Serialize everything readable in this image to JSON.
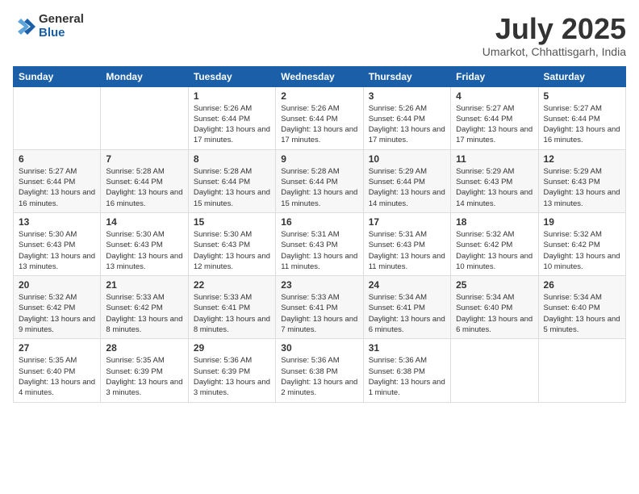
{
  "logo": {
    "general": "General",
    "blue": "Blue"
  },
  "header": {
    "month_year": "July 2025",
    "location": "Umarkot, Chhattisgarh, India"
  },
  "weekdays": [
    "Sunday",
    "Monday",
    "Tuesday",
    "Wednesday",
    "Thursday",
    "Friday",
    "Saturday"
  ],
  "weeks": [
    [
      {
        "day": "",
        "info": ""
      },
      {
        "day": "",
        "info": ""
      },
      {
        "day": "1",
        "info": "Sunrise: 5:26 AM\nSunset: 6:44 PM\nDaylight: 13 hours and 17 minutes."
      },
      {
        "day": "2",
        "info": "Sunrise: 5:26 AM\nSunset: 6:44 PM\nDaylight: 13 hours and 17 minutes."
      },
      {
        "day": "3",
        "info": "Sunrise: 5:26 AM\nSunset: 6:44 PM\nDaylight: 13 hours and 17 minutes."
      },
      {
        "day": "4",
        "info": "Sunrise: 5:27 AM\nSunset: 6:44 PM\nDaylight: 13 hours and 17 minutes."
      },
      {
        "day": "5",
        "info": "Sunrise: 5:27 AM\nSunset: 6:44 PM\nDaylight: 13 hours and 16 minutes."
      }
    ],
    [
      {
        "day": "6",
        "info": "Sunrise: 5:27 AM\nSunset: 6:44 PM\nDaylight: 13 hours and 16 minutes."
      },
      {
        "day": "7",
        "info": "Sunrise: 5:28 AM\nSunset: 6:44 PM\nDaylight: 13 hours and 16 minutes."
      },
      {
        "day": "8",
        "info": "Sunrise: 5:28 AM\nSunset: 6:44 PM\nDaylight: 13 hours and 15 minutes."
      },
      {
        "day": "9",
        "info": "Sunrise: 5:28 AM\nSunset: 6:44 PM\nDaylight: 13 hours and 15 minutes."
      },
      {
        "day": "10",
        "info": "Sunrise: 5:29 AM\nSunset: 6:44 PM\nDaylight: 13 hours and 14 minutes."
      },
      {
        "day": "11",
        "info": "Sunrise: 5:29 AM\nSunset: 6:43 PM\nDaylight: 13 hours and 14 minutes."
      },
      {
        "day": "12",
        "info": "Sunrise: 5:29 AM\nSunset: 6:43 PM\nDaylight: 13 hours and 13 minutes."
      }
    ],
    [
      {
        "day": "13",
        "info": "Sunrise: 5:30 AM\nSunset: 6:43 PM\nDaylight: 13 hours and 13 minutes."
      },
      {
        "day": "14",
        "info": "Sunrise: 5:30 AM\nSunset: 6:43 PM\nDaylight: 13 hours and 13 minutes."
      },
      {
        "day": "15",
        "info": "Sunrise: 5:30 AM\nSunset: 6:43 PM\nDaylight: 13 hours and 12 minutes."
      },
      {
        "day": "16",
        "info": "Sunrise: 5:31 AM\nSunset: 6:43 PM\nDaylight: 13 hours and 11 minutes."
      },
      {
        "day": "17",
        "info": "Sunrise: 5:31 AM\nSunset: 6:43 PM\nDaylight: 13 hours and 11 minutes."
      },
      {
        "day": "18",
        "info": "Sunrise: 5:32 AM\nSunset: 6:42 PM\nDaylight: 13 hours and 10 minutes."
      },
      {
        "day": "19",
        "info": "Sunrise: 5:32 AM\nSunset: 6:42 PM\nDaylight: 13 hours and 10 minutes."
      }
    ],
    [
      {
        "day": "20",
        "info": "Sunrise: 5:32 AM\nSunset: 6:42 PM\nDaylight: 13 hours and 9 minutes."
      },
      {
        "day": "21",
        "info": "Sunrise: 5:33 AM\nSunset: 6:42 PM\nDaylight: 13 hours and 8 minutes."
      },
      {
        "day": "22",
        "info": "Sunrise: 5:33 AM\nSunset: 6:41 PM\nDaylight: 13 hours and 8 minutes."
      },
      {
        "day": "23",
        "info": "Sunrise: 5:33 AM\nSunset: 6:41 PM\nDaylight: 13 hours and 7 minutes."
      },
      {
        "day": "24",
        "info": "Sunrise: 5:34 AM\nSunset: 6:41 PM\nDaylight: 13 hours and 6 minutes."
      },
      {
        "day": "25",
        "info": "Sunrise: 5:34 AM\nSunset: 6:40 PM\nDaylight: 13 hours and 6 minutes."
      },
      {
        "day": "26",
        "info": "Sunrise: 5:34 AM\nSunset: 6:40 PM\nDaylight: 13 hours and 5 minutes."
      }
    ],
    [
      {
        "day": "27",
        "info": "Sunrise: 5:35 AM\nSunset: 6:40 PM\nDaylight: 13 hours and 4 minutes."
      },
      {
        "day": "28",
        "info": "Sunrise: 5:35 AM\nSunset: 6:39 PM\nDaylight: 13 hours and 3 minutes."
      },
      {
        "day": "29",
        "info": "Sunrise: 5:36 AM\nSunset: 6:39 PM\nDaylight: 13 hours and 3 minutes."
      },
      {
        "day": "30",
        "info": "Sunrise: 5:36 AM\nSunset: 6:38 PM\nDaylight: 13 hours and 2 minutes."
      },
      {
        "day": "31",
        "info": "Sunrise: 5:36 AM\nSunset: 6:38 PM\nDaylight: 13 hours and 1 minute."
      },
      {
        "day": "",
        "info": ""
      },
      {
        "day": "",
        "info": ""
      }
    ]
  ]
}
